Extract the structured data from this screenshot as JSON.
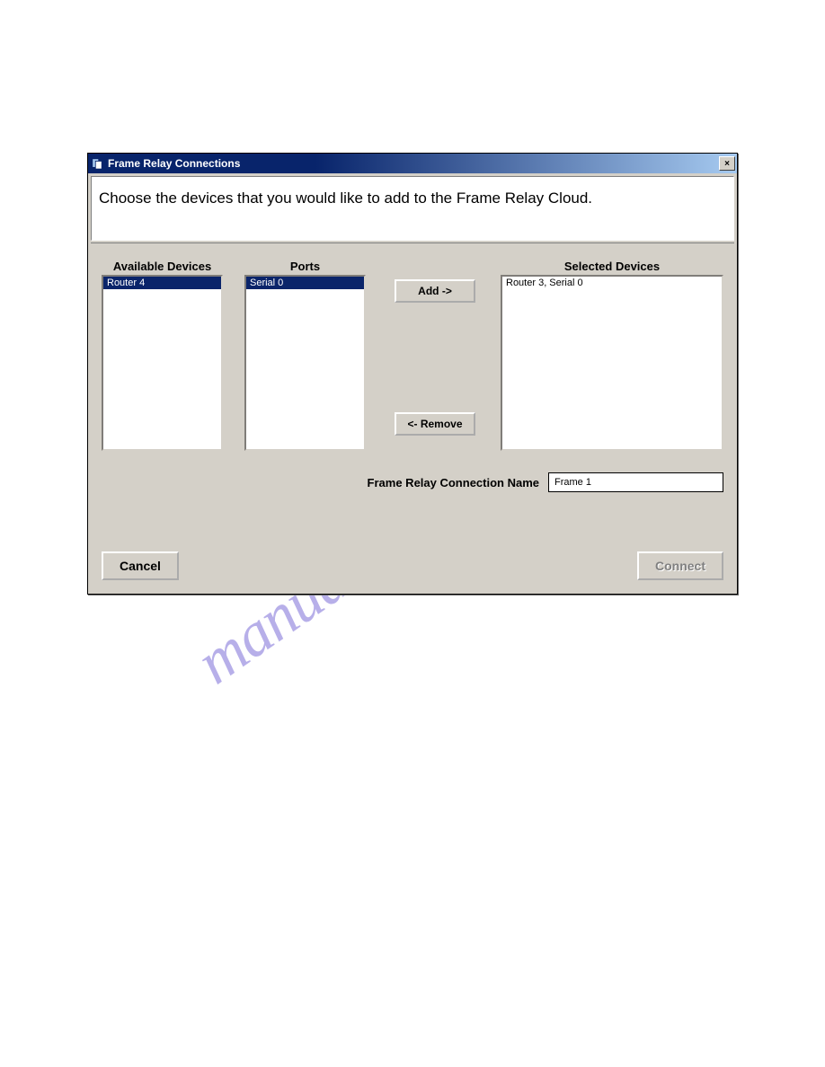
{
  "watermark": "manualshive.com",
  "window": {
    "title": "Frame Relay Connections",
    "close_label": "×",
    "instruction": "Choose the devices that you would like to add to the Frame Relay Cloud."
  },
  "columns": {
    "available_header": "Available Devices",
    "ports_header": "Ports",
    "selected_header": "Selected Devices",
    "available_items": [
      "Router 4"
    ],
    "ports_items": [
      "Serial 0"
    ],
    "selected_items": [
      "Router 3,   Serial 0"
    ]
  },
  "buttons": {
    "add": "Add ->",
    "remove": "<- Remove",
    "cancel": "Cancel",
    "connect": "Connect"
  },
  "connection_name": {
    "label": "Frame Relay Connection Name",
    "value": "Frame 1"
  }
}
